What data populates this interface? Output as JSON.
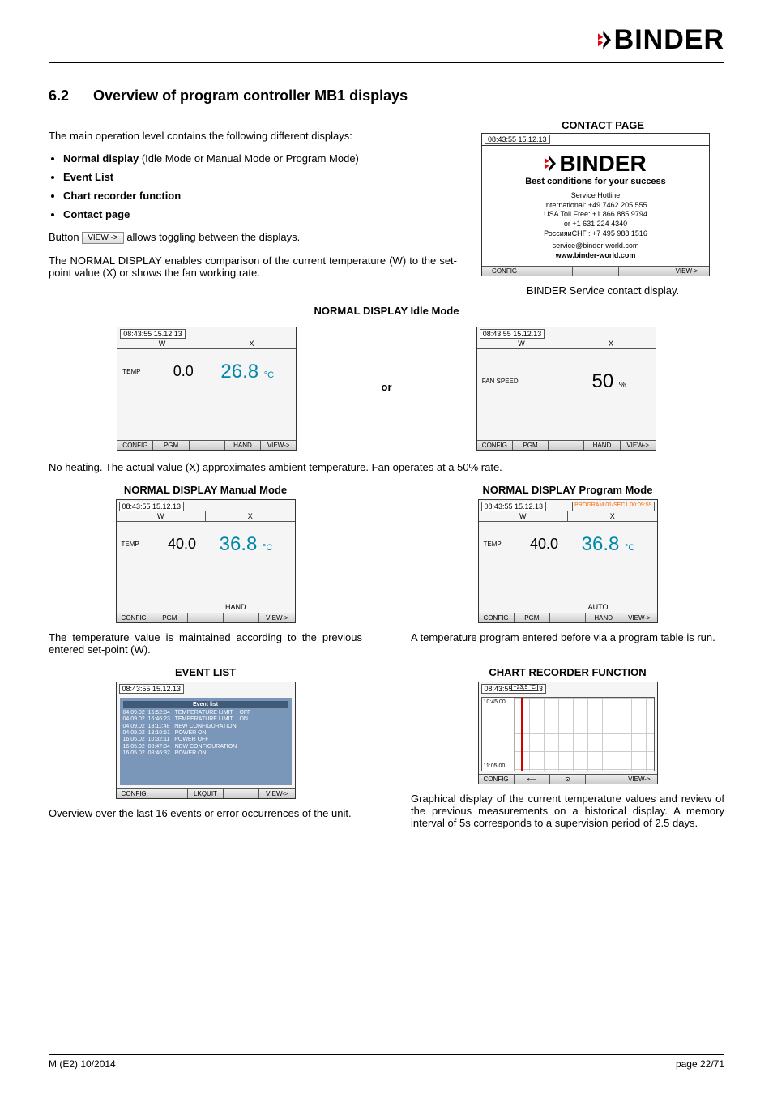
{
  "header": {
    "brand": "BINDER"
  },
  "section": {
    "num": "6.2",
    "title": "Overview of program controller MB1 displays"
  },
  "intro": "The main operation level contains the following different displays:",
  "bullets": [
    {
      "label": "Normal display",
      "suffix": " (Idle Mode or Manual Mode or Program Mode)"
    },
    {
      "label": "Event List",
      "suffix": ""
    },
    {
      "label": "Chart recorder function",
      "suffix": ""
    },
    {
      "label": "Contact page",
      "suffix": ""
    }
  ],
  "button_line_a": "Button ",
  "button_view": "VIEW ->",
  "button_line_b": " allows toggling between the displays.",
  "normal_p": "The NORMAL DISPLAY enables comparison of the current temperature (W) to the set-point value (X) or shows the fan working rate.",
  "contact": {
    "title": "CONTACT PAGE",
    "timestamp": "08:43:55  15.12.13",
    "brand": "BINDER",
    "slogan": "Best conditions for your success",
    "hotline_lbl": "Service Hotline",
    "line_intl": "International:   +49 7462 205 555",
    "line_usa": "USA Toll Free: +1 866 885 9794",
    "line_or": "or +1 631 224 4340",
    "line_ru": "РоссияиСНГ : +7 495 988 1516",
    "email": "service@binder-world.com",
    "web": "www.binder-world.com",
    "caption": "BINDER Service contact display.",
    "config": "CONFIG",
    "view": "VIEW->"
  },
  "idle": {
    "caption": "NORMAL DISPLAY  Idle Mode",
    "ts": "08:43:55  15.12.13",
    "w": "W",
    "x": "X",
    "temp_lbl": "TEMP",
    "w_val": "0.0",
    "x_val": "26.8",
    "x_unit": "°C",
    "fan_lbl": "FAN SPEED",
    "fan_val": "50",
    "fan_unit": "%",
    "or": "or",
    "btns": [
      "CONFIG",
      "PGM",
      "",
      "HAND",
      "VIEW->"
    ]
  },
  "idle_note": "No heating. The actual value (X) approximates ambient temperature. Fan operates at a 50% rate.",
  "manual": {
    "caption": "NORMAL DISPLAY  Manual Mode",
    "ts": "08:43:55  15.12.13",
    "temp_lbl": "TEMP",
    "w_val": "40.0",
    "x_val": "36.8",
    "x_unit": "°C",
    "mode": "HAND",
    "btns": [
      "CONFIG",
      "PGM",
      "",
      "",
      "VIEW->"
    ],
    "note": "The temperature value is maintained according to the previous entered set-point (W)."
  },
  "program": {
    "caption": "NORMAL DISPLAY  Program Mode",
    "ts": "08:43:55  15.12.13",
    "prog": "PROGRAM 01/SEC1 00:09:59",
    "temp_lbl": "TEMP",
    "w_val": "40.0",
    "x_val": "36.8",
    "x_unit": "°C",
    "mode": "AUTO",
    "btns": [
      "CONFIG",
      "PGM",
      "",
      "HAND",
      "VIEW->"
    ],
    "note": "A temperature program entered before via a program table is run."
  },
  "eventlist": {
    "caption": "EVENT LIST",
    "ts": "08:43:55  15.12.13",
    "title": "Event list",
    "rows": [
      "04.09.02  16:52:34   TEMPERATURE LIMIT    OFF",
      "04.09.02  16:46:23   TEMPERATURE LIMIT    ON",
      "04.09.02  13:11:48   NEW CONFIGURATION",
      "04.09.02  13:10:51   POWER ON",
      "16.05.02  10:32:11   POWER OFF",
      "16.05.02  08:47:34   NEW CONFIGURATION",
      "16.05.02  08:46:32   POWER ON"
    ],
    "btns": [
      "CONFIG",
      "",
      "LKQUIT",
      "",
      "VIEW->"
    ],
    "note": "Overview over the last 16 events or error occurrences of the unit."
  },
  "chartrec": {
    "caption": "CHART RECORDER FUNCTION",
    "ts": "08:43:55  15.12.13",
    "topval": "+23,9  °C",
    "y1": "10:45.00",
    "y2": "11:05.00",
    "btns": [
      "CONFIG",
      "⟵",
      "⊙",
      "",
      "VIEW->"
    ],
    "note": "Graphical display of the current temperature values and review of the previous measurements on a historical display. A memory interval of 5s corresponds to a supervision period of 2.5 days."
  },
  "footer": {
    "left": "M (E2) 10/2014",
    "right": "page 22/71"
  }
}
